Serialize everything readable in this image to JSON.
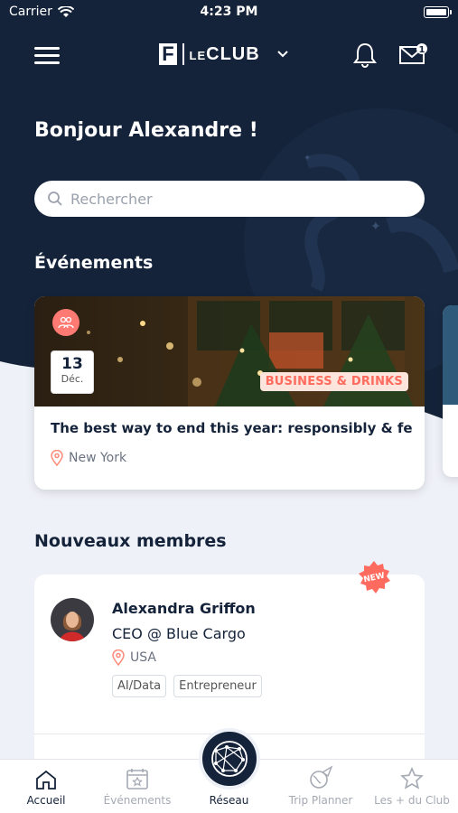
{
  "status_bar": {
    "carrier": "Carrier",
    "time": "4:23 PM"
  },
  "header": {
    "brand_small": "LE",
    "brand_main": "CLUB",
    "mail_badge": "1"
  },
  "greeting": "Bonjour Alexandre !",
  "search": {
    "placeholder": "Rechercher"
  },
  "events": {
    "section_title": "Événements",
    "card": {
      "day": "13",
      "month": "Déc.",
      "category": "BUSINESS & DRINKS",
      "title": "The best way to end this year: responsibly & fe...",
      "location": "New York"
    }
  },
  "members": {
    "section_title": "Nouveaux membres",
    "new_badge": "NEW",
    "card": {
      "name": "Alexandra Griffon",
      "role": "CEO @ Blue Cargo",
      "location": "USA",
      "tags": [
        "AI/Data",
        "Entrepreneur"
      ]
    }
  },
  "tabbar": {
    "tabs": [
      {
        "label": "Accueil",
        "icon": "home-icon",
        "active": true
      },
      {
        "label": "Événements",
        "icon": "calendar-icon",
        "active": false
      },
      {
        "label": "Réseau",
        "icon": "globe-network-icon",
        "active": false
      },
      {
        "label": "Trip Planner",
        "icon": "plane-globe-icon",
        "active": false
      },
      {
        "label": "Les + du Club",
        "icon": "star-icon",
        "active": false
      }
    ]
  },
  "colors": {
    "navy": "#15233a",
    "accent_coral": "#ff6b5e",
    "background": "#eef1f7"
  }
}
